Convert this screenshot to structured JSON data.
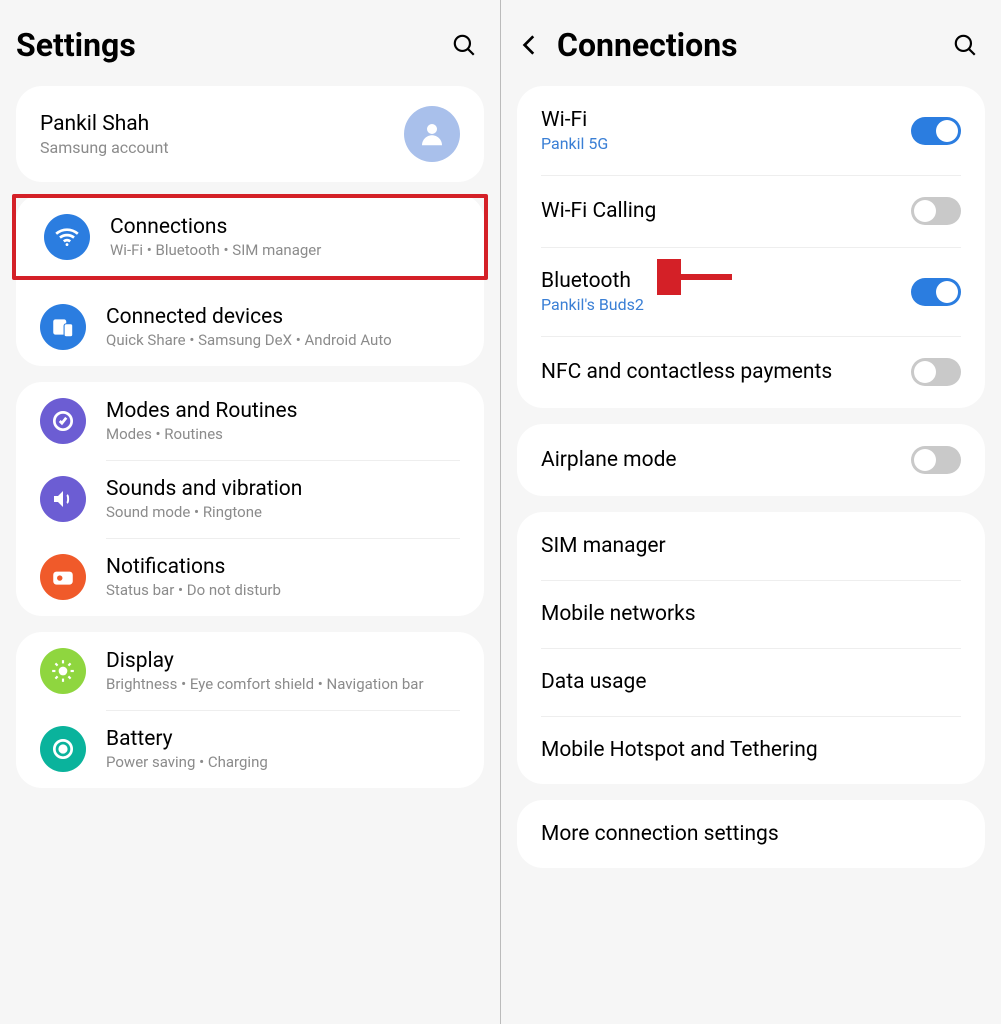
{
  "left": {
    "title": "Settings",
    "account": {
      "name": "Pankil Shah",
      "sub": "Samsung account"
    },
    "groups": [
      [
        {
          "title": "Connections",
          "sub": "Wi-Fi  •  Bluetooth  •  SIM manager",
          "icon": "wifi",
          "highlight": true
        },
        {
          "title": "Connected devices",
          "sub": "Quick Share  •  Samsung DeX  •  Android Auto",
          "icon": "devices"
        }
      ],
      [
        {
          "title": "Modes and Routines",
          "sub": "Modes  •  Routines",
          "icon": "modes"
        },
        {
          "title": "Sounds and vibration",
          "sub": "Sound mode  •  Ringtone",
          "icon": "sound"
        },
        {
          "title": "Notifications",
          "sub": "Status bar  •  Do not disturb",
          "icon": "notif"
        }
      ],
      [
        {
          "title": "Display",
          "sub": "Brightness  •  Eye comfort shield  •  Navigation bar",
          "icon": "display"
        },
        {
          "title": "Battery",
          "sub": "Power saving  •  Charging",
          "icon": "battery"
        }
      ]
    ]
  },
  "right": {
    "title": "Connections",
    "groups": [
      [
        {
          "title": "Wi-Fi",
          "sub": "Pankil 5G",
          "toggle": true
        },
        {
          "title": "Wi-Fi Calling",
          "toggle": false
        },
        {
          "title": "Bluetooth",
          "sub": "Pankil's Buds2",
          "toggle": true,
          "arrow": true
        },
        {
          "title": "NFC and contactless payments",
          "toggle": false
        }
      ],
      [
        {
          "title": "Airplane mode",
          "toggle": false
        }
      ],
      [
        {
          "title": "SIM manager"
        },
        {
          "title": "Mobile networks"
        },
        {
          "title": "Data usage"
        },
        {
          "title": "Mobile Hotspot and Tethering"
        }
      ],
      [
        {
          "title": "More connection settings"
        }
      ]
    ]
  }
}
